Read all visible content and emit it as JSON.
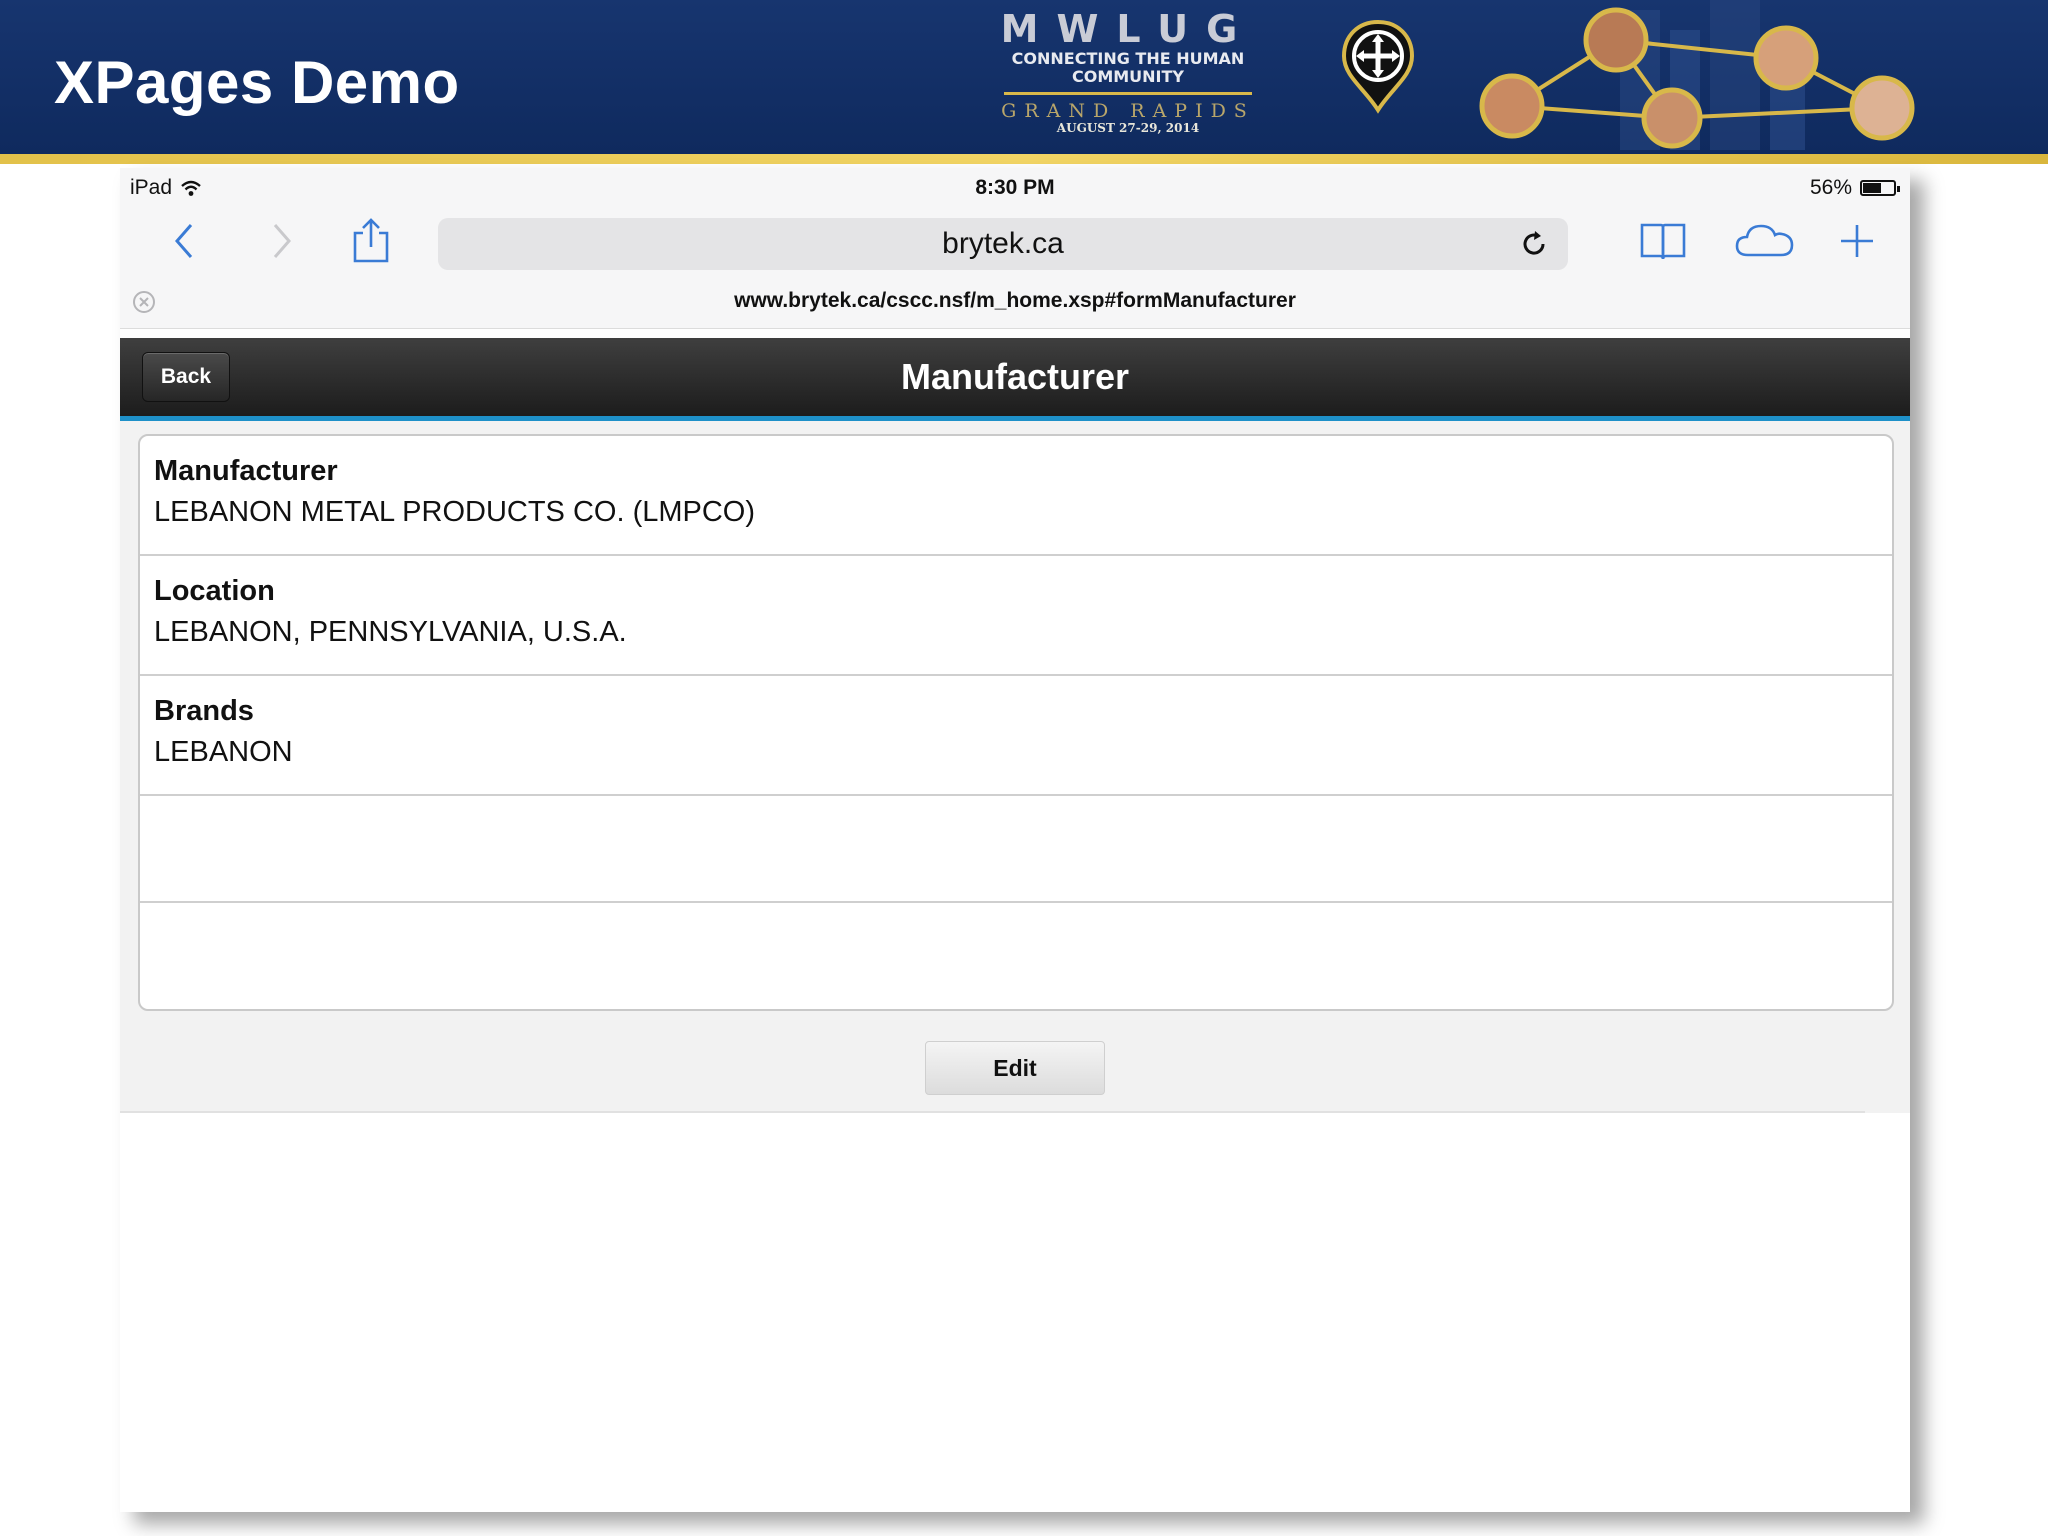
{
  "slide": {
    "title": "XPages Demo"
  },
  "logo": {
    "word": "MWLUG",
    "tagline_line1": "CONNECTING THE HUMAN",
    "tagline_line2": "COMMUNITY",
    "city": "GRAND RAPIDS",
    "dates": "AUGUST 27-29, 2014",
    "rule_color": "#d8b84a"
  },
  "colors": {
    "banner": "#17356f",
    "banner_rule": "#e2c14a",
    "nav_header": "#1c1c1c",
    "nav_accent": "#1e90c8",
    "ios_tint": "#3a7bd5"
  },
  "status_bar": {
    "device": "iPad",
    "time": "8:30 PM",
    "battery": "56%",
    "battery_level": 0.56
  },
  "browser": {
    "address": "brytek.ca",
    "full_url": "www.brytek.ca/cscc.nsf/m_home.xsp#formManufacturer",
    "icons": [
      "back-icon",
      "forward-icon",
      "share-icon",
      "reload-icon",
      "bookmarks-icon",
      "icloud-tabs-icon",
      "new-tab-icon",
      "close-tab-icon"
    ]
  },
  "app": {
    "back_label": "Back",
    "title": "Manufacturer",
    "fields": [
      {
        "label": "Manufacturer",
        "value": "LEBANON METAL PRODUCTS CO. (LMPCO)"
      },
      {
        "label": "Location",
        "value": "LEBANON, PENNSYLVANIA, U.S.A."
      },
      {
        "label": "Brands",
        "value": "LEBANON"
      }
    ],
    "edit_label": "Edit"
  }
}
